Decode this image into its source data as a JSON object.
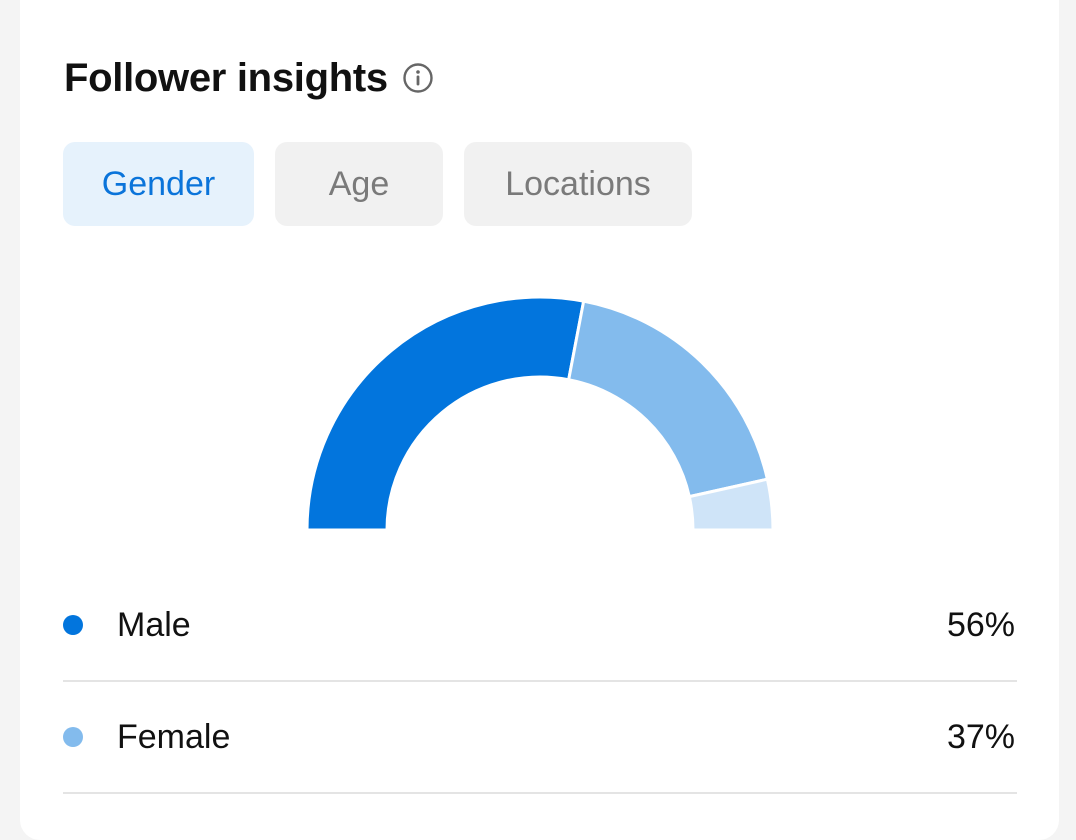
{
  "header": {
    "title": "Follower insights",
    "info_icon": "info-icon"
  },
  "tabs": [
    {
      "label": "Gender",
      "active": true
    },
    {
      "label": "Age",
      "active": false
    },
    {
      "label": "Locations",
      "active": false
    }
  ],
  "colors": {
    "male": "#0275dd",
    "female": "#83bbed",
    "other": "#cfe4f8",
    "active_tab_text": "#0a74da",
    "active_tab_bg": "#e6f2fc"
  },
  "chart_data": {
    "type": "pie",
    "categories": [
      "Male",
      "Female",
      ""
    ],
    "values": [
      56,
      37,
      7
    ]
  },
  "legend": [
    {
      "label": "Male",
      "value": "56%",
      "color": "#0275dd"
    },
    {
      "label": "Female",
      "value": "37%",
      "color": "#83bbed"
    }
  ]
}
